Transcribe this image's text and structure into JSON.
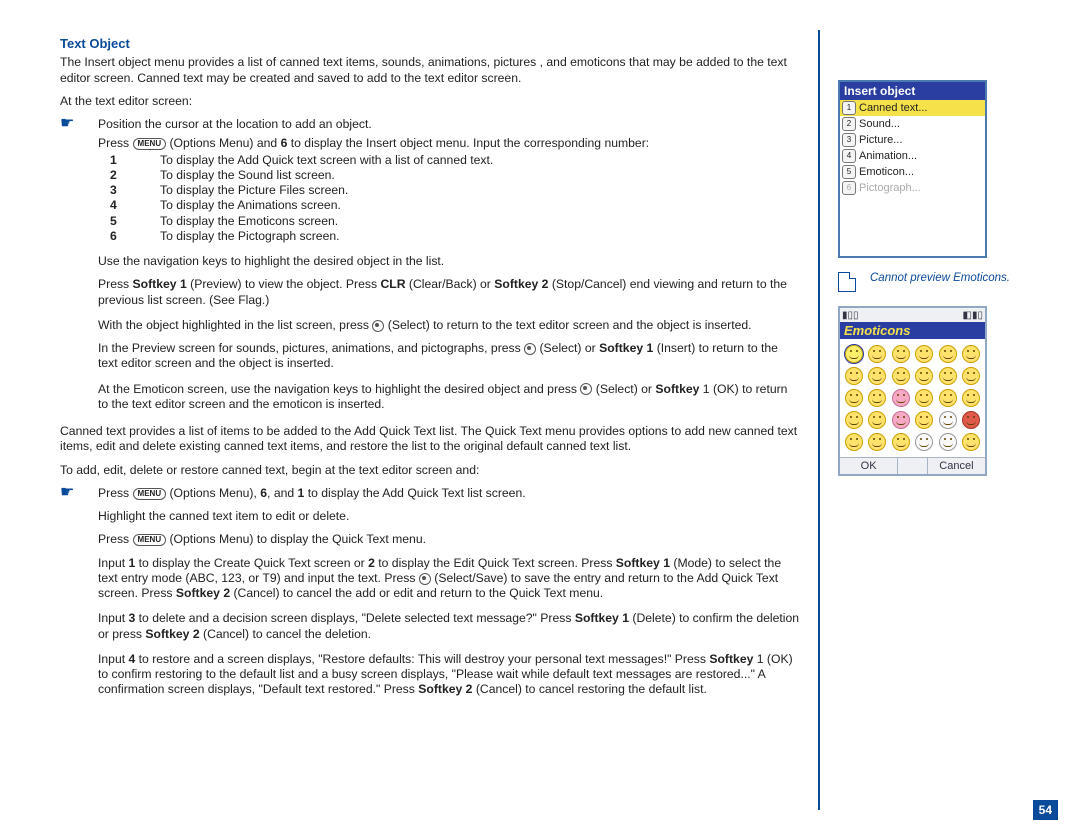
{
  "title": "Text Object",
  "intro": "The Insert object menu provides a list of canned text items, sounds, animations, pictures , and emoticons that may be added to the text editor screen. Canned text may be created and saved to add to the text editor screen.",
  "at_editor": "At the text editor screen:",
  "step_position": "Position the cursor at the location to add an object.",
  "step_press_menu_pre": "Press ",
  "menu_label": "MENU",
  "step_press_menu_mid": " (Options Menu) and ",
  "six": "6",
  "step_press_menu_post": " to display the Insert object menu. Input the corresponding number:",
  "numlist": [
    {
      "n": "1",
      "t": "To display the Add Quick text screen with a list of canned text."
    },
    {
      "n": "2",
      "t": "To display the Sound list screen."
    },
    {
      "n": "3",
      "t": "To display the Picture Files screen."
    },
    {
      "n": "4",
      "t": "To display the Animations screen."
    },
    {
      "n": "5",
      "t": "To display the Emoticons screen."
    },
    {
      "n": "6",
      "t": "To display the Pictograph screen."
    }
  ],
  "use_nav": "Use the navigation keys to highlight the desired object in the list.",
  "preview_line": {
    "a": "Press ",
    "b": "Softkey 1",
    "c": " (Preview) to view the object. Press ",
    "d": "CLR",
    "e": " (Clear/Back) or ",
    "f": "Softkey 2",
    "g": " (Stop/Cancel) end viewing and return to the previous list screen. (See Flag.)"
  },
  "select_line": {
    "a": "With the object highlighted in the list screen, press ",
    "b": " (Select) to return to the text editor screen and the object is inserted."
  },
  "preview_screen": {
    "a": "In the Preview screen for sounds, pictures, animations, and pictographs, press ",
    "b": " (Select) or ",
    "c": "Softkey 1",
    "d": " (Insert) to return to the text editor screen and the object is inserted."
  },
  "emoticon_line": {
    "a": "At the Emoticon screen, use the navigation keys to highlight the desired object and press ",
    "b": " (Select) or ",
    "c": "Softkey",
    "d": " 1 (OK) to return to the text editor screen and the emoticon is inserted."
  },
  "canned_para": "Canned text provides a list of items to be added to the Add Quick Text list. The Quick Text menu provides options to add new canned text items, edit and delete existing canned text items, and restore the list to the original default canned text list.",
  "to_add": "To add, edit, delete or restore canned text, begin at the text editor screen and:",
  "b1": {
    "a": "Press ",
    "b": " (Options Menu), ",
    "c": "6",
    "d": ", and ",
    "e": "1",
    "f": " to display the Add Quick Text list screen."
  },
  "b2": "Highlight the canned text item to edit or delete.",
  "b3": {
    "a": "Press ",
    "b": " (Options Menu) to display the Quick Text menu."
  },
  "b4": {
    "a": "Input ",
    "b": "1",
    "c": " to display the Create Quick Text screen or ",
    "d": "2",
    "e": " to display the Edit Quick Text screen. Press ",
    "f": "Softkey 1",
    "g": " (Mode) to select the text entry mode (ABC, 123, or T9) and input the text. Press ",
    "h": " (Select/Save) to save the entry and return to the Add Quick Text screen. Press ",
    "i": "Softkey 2",
    "j": " (Cancel) to cancel the add or edit and return to the Quick Text menu."
  },
  "b5": {
    "a": "Input ",
    "b": "3",
    "c": " to delete and a decision screen displays, \"Delete selected text message?\" Press ",
    "d": "Softkey 1",
    "e": " (Delete) to confirm the deletion or press ",
    "f": "Softkey 2",
    "g": " (Cancel) to cancel the deletion."
  },
  "b6": {
    "a": "Input ",
    "b": "4",
    "c": " to restore and a screen displays, \"Restore defaults: This will destroy your personal text messages!\" Press ",
    "d": "Softkey",
    "e": " 1 (OK) to confirm restoring to the default list and a busy screen displays, \"Please wait while default text messages are restored...\" A confirmation screen displays, \"Default text restored.\" Press ",
    "f": "Softkey 2",
    "g": " (Cancel) to cancel restoring the default list."
  },
  "phone1": {
    "title": "Insert object",
    "items": [
      "Canned text...",
      "Sound...",
      "Picture...",
      "Animation...",
      "Emoticon...",
      "Pictograph..."
    ]
  },
  "note": "Cannot preview Emoticons.",
  "phone2": {
    "title": "Emoticons",
    "left": "OK",
    "right": "Cancel"
  },
  "page_number": "54"
}
